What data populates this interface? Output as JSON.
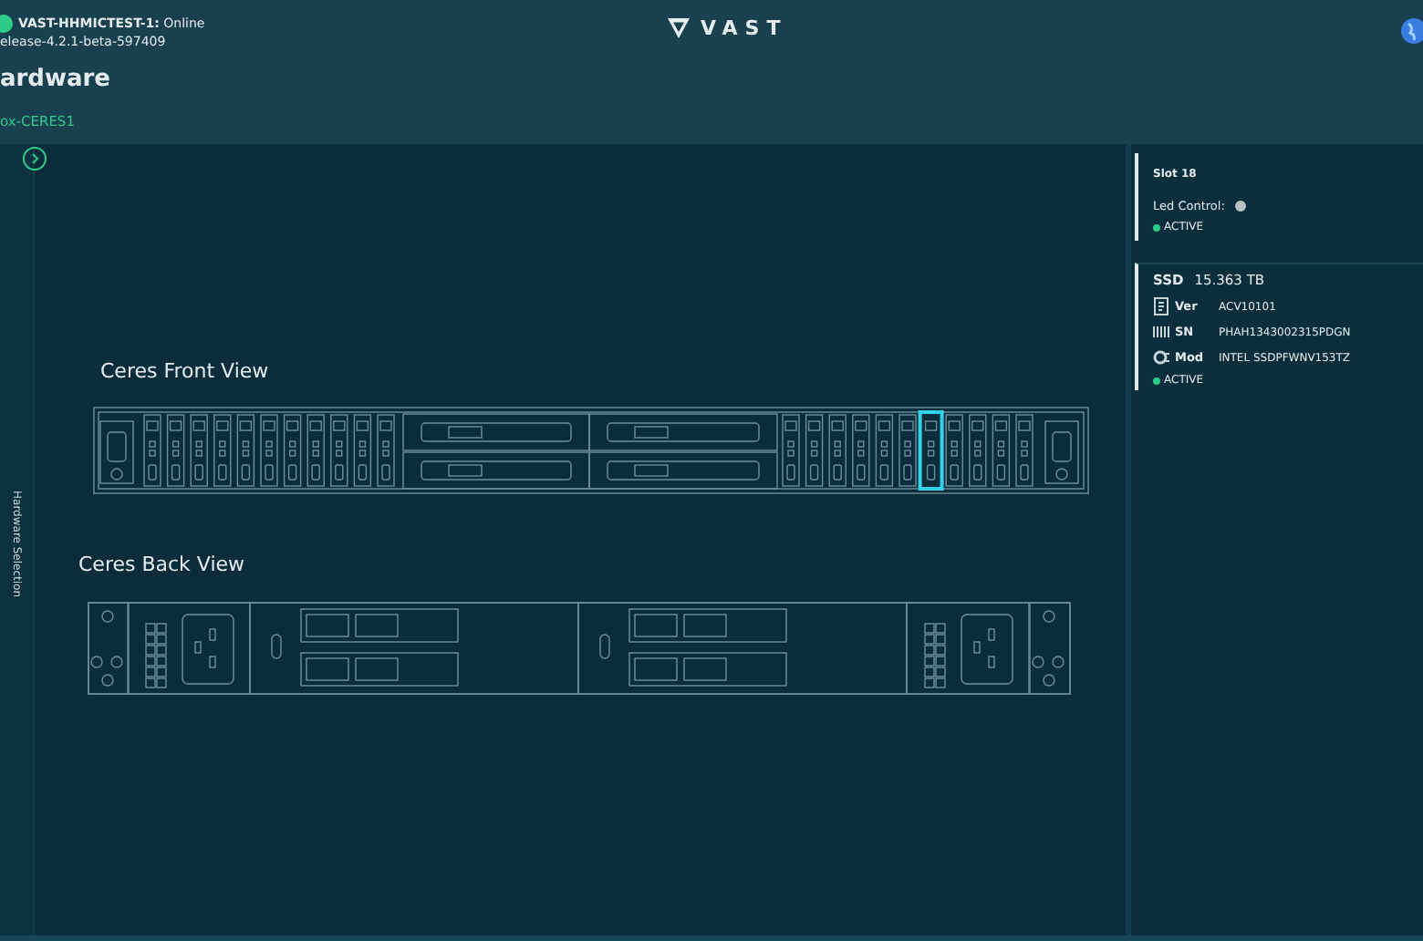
{
  "header": {
    "cluster": "**VAST-HHMICTEST-1:** Online",
    "release": "elease-4.2.1-beta-597409",
    "title": "ardware",
    "breadcrumb": "ox-CERES1",
    "logo": "VAST"
  },
  "side_tab": "Hardware Selection",
  "front_view": {
    "title": "Ceres Front View",
    "slots": [
      {
        "selected": false
      },
      {
        "selected": false
      },
      {
        "selected": false
      },
      {
        "selected": false
      },
      {
        "selected": false
      },
      {
        "selected": false
      },
      {
        "selected": false
      },
      {
        "selected": false
      },
      {
        "selected": false
      },
      {
        "selected": false
      },
      {
        "selected": false
      },
      {
        "selected": false
      },
      {
        "selected": false
      },
      {
        "selected": false
      },
      {
        "selected": false
      },
      {
        "selected": false
      },
      {
        "selected": false
      },
      {
        "selected": true
      },
      {
        "selected": false
      },
      {
        "selected": false
      },
      {
        "selected": false
      },
      {
        "selected": false
      }
    ]
  },
  "back_view": {
    "title": "Ceres Back View"
  },
  "slot_card": {
    "title": "Slot 18",
    "led_label": "Led Control:",
    "status": {
      "label": "ACTIVE",
      "color": "#2ecc8a"
    }
  },
  "ssd_card": {
    "type": "SSD",
    "capacity": "15.363 TB",
    "rows": [
      {
        "kind": "version",
        "label": "Ver",
        "value": "ACV10101"
      },
      {
        "kind": "serial",
        "label": "SN",
        "value": "PHAH1343002315PDGN"
      },
      {
        "kind": "model",
        "label": "Mod",
        "value": "INTEL SSDPFWNV153TZ"
      }
    ],
    "status": {
      "label": "ACTIVE",
      "color": "#2ecc8a"
    }
  }
}
